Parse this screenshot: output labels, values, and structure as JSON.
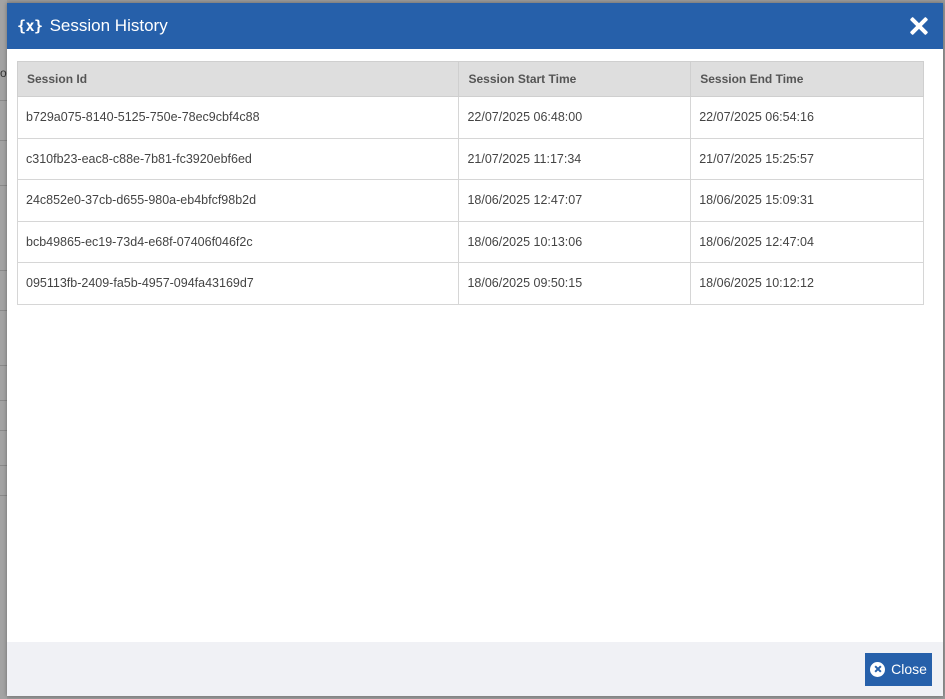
{
  "modal": {
    "icon": "{x}",
    "icon_name": "variable-icon",
    "title": "Session History",
    "close_icon": "close-icon"
  },
  "table": {
    "headers": [
      "Session Id",
      "Session Start Time",
      "Session End Time"
    ],
    "rows": [
      [
        "b729a075-8140-5125-750e-78ec9cbf4c88",
        "22/07/2025 06:48:00",
        "22/07/2025 06:54:16"
      ],
      [
        "c310fb23-eac8-c88e-7b81-fc3920ebf6ed",
        "21/07/2025 11:17:34",
        "21/07/2025 15:25:57"
      ],
      [
        "24c852e0-37cb-d655-980a-eb4bfcf98b2d",
        "18/06/2025 12:47:07",
        "18/06/2025 15:09:31"
      ],
      [
        "bcb49865-ec19-73d4-e68f-07406f046f2c",
        "18/06/2025 10:13:06",
        "18/06/2025 12:47:04"
      ],
      [
        "095113fb-2409-fa5b-4957-094fa43169d7",
        "18/06/2025 09:50:15",
        "18/06/2025 10:12:12"
      ]
    ]
  },
  "footer": {
    "close_label": "Close",
    "close_icon": "circle-close-icon"
  },
  "background": {
    "peek_text": "o"
  },
  "colors": {
    "header_bg": "#2660aa",
    "table_header_bg": "#dedede",
    "footer_bg": "#f0f1f5"
  }
}
